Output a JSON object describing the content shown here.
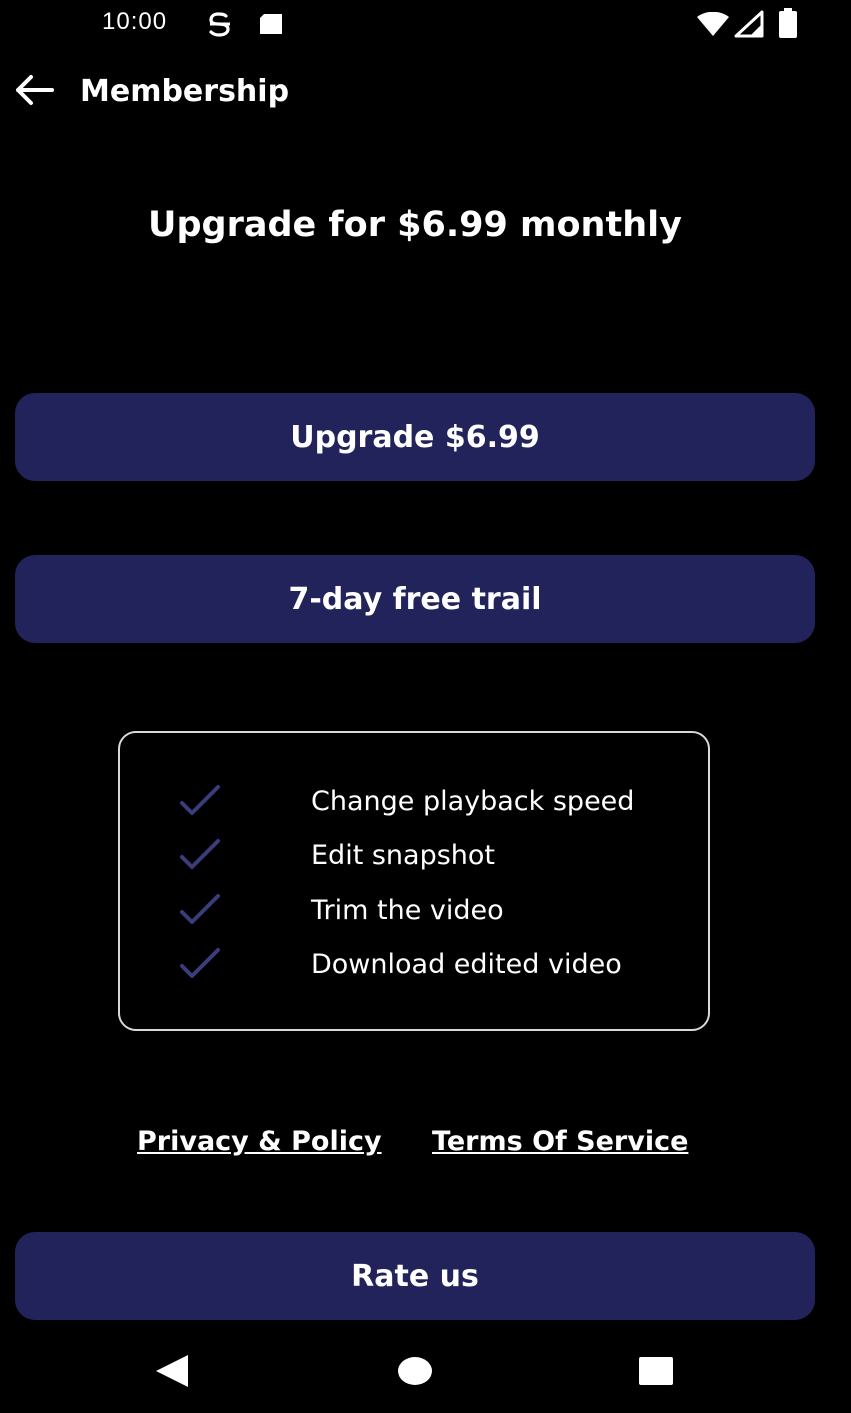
{
  "status_bar": {
    "time": "10:00"
  },
  "app_bar": {
    "title": "Membership"
  },
  "headline": "Upgrade for $6.99 monthly",
  "buttons": {
    "upgrade_label": "Upgrade $6.99",
    "trial_label": "7-day free trail",
    "rate_label": "Rate us"
  },
  "features": [
    "Change playback speed",
    "Edit snapshot",
    "Trim the video",
    "Download edited video"
  ],
  "links": {
    "privacy": "Privacy & Policy",
    "terms": "Terms Of Service"
  },
  "colors": {
    "background": "#000000",
    "button": "#22235a",
    "check": "#3b3d7a",
    "text": "#ffffff"
  },
  "icons": {
    "back": "arrow-left-icon",
    "check": "check-icon",
    "nav_back": "triangle-back-icon",
    "nav_home": "circle-home-icon",
    "nav_recents": "square-recents-icon"
  }
}
